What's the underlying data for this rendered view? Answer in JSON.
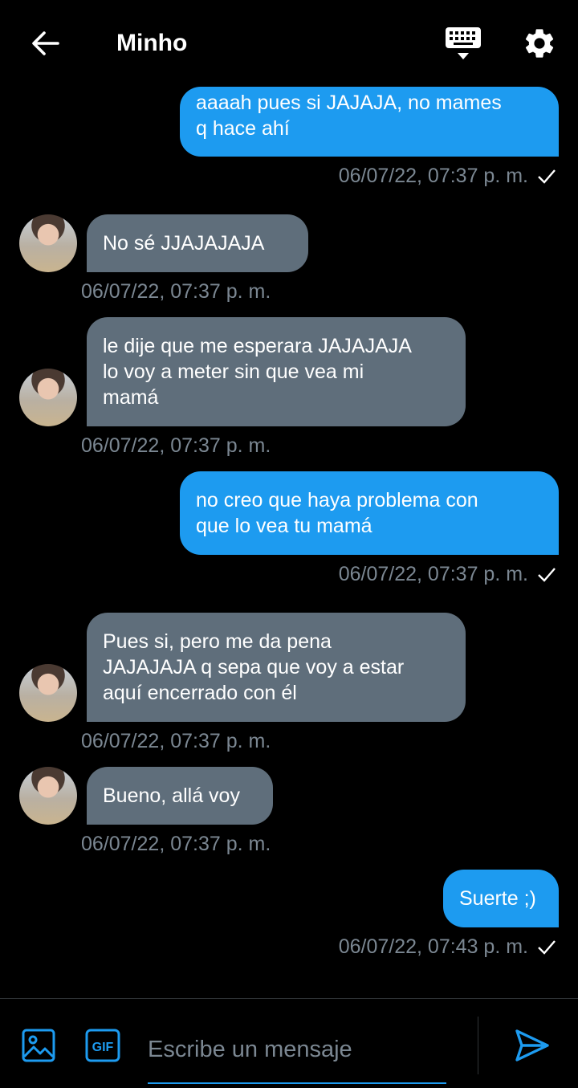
{
  "header": {
    "title": "Minho",
    "back_icon": "arrow-left-icon",
    "keyboard_icon": "keyboard-icon",
    "settings_icon": "gear-icon"
  },
  "messages": [
    {
      "dir": "out",
      "text": "aaaah pues si JAJAJA, no mames\nq hace ahí",
      "time": "06/07/22, 07:37 p. m.",
      "read": true
    },
    {
      "dir": "in",
      "text": "No sé JJAJAJAJA",
      "time": "06/07/22, 07:37 p. m."
    },
    {
      "dir": "in",
      "text": "le dije que me esperara JAJAJAJA\nlo voy a meter sin que vea mi\nmamá",
      "time": "06/07/22, 07:37 p. m."
    },
    {
      "dir": "out",
      "text": "no creo que haya problema con\nque lo vea tu mamá",
      "time": "06/07/22, 07:37 p. m.",
      "read": true
    },
    {
      "dir": "in",
      "text": "Pues si, pero me da pena\nJAJAJAJA q sepa que voy a estar\naquí encerrado con él",
      "time": "06/07/22, 07:37 p. m."
    },
    {
      "dir": "in",
      "text": "Bueno, allá voy",
      "time": "06/07/22, 07:37 p. m."
    },
    {
      "dir": "out",
      "text": "Suerte ;)",
      "time": "06/07/22, 07:43 p. m.",
      "read": true
    }
  ],
  "composer": {
    "placeholder": "Escribe un mensaje",
    "gif_label": "GIF",
    "image_icon": "image-icon",
    "send_icon": "send-icon"
  },
  "colors": {
    "accent": "#1d9bf0",
    "incoming_bubble": "#5f6e7b",
    "timestamp": "#7b8792",
    "background": "#000000"
  }
}
